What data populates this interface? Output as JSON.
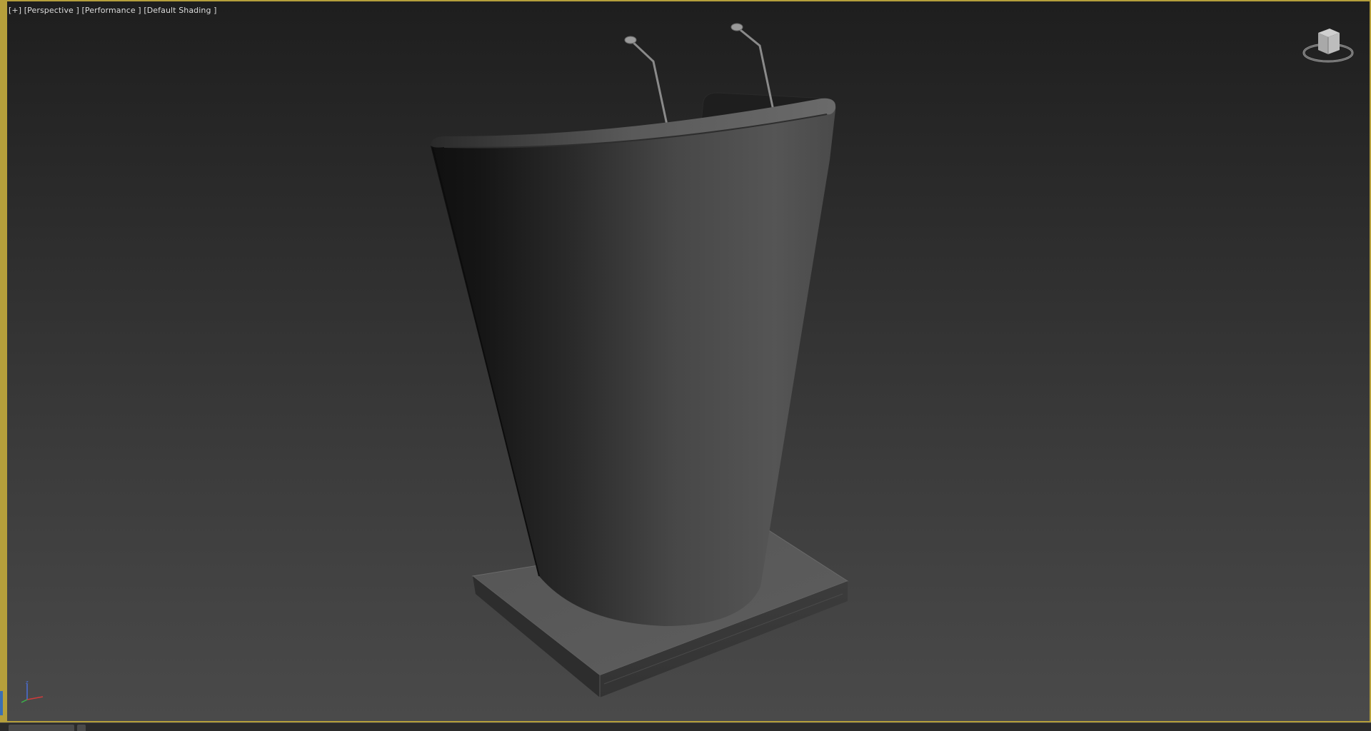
{
  "viewport": {
    "label_plus": "[+]",
    "label_view": "[Perspective ]",
    "label_performance": "[Performance ]",
    "label_shading": "[Default Shading ]"
  },
  "colors": {
    "viewport_border": "#b59f3b",
    "background_top": "#1e1e1e",
    "background_bottom": "#4a4a4a",
    "model_dark": "#121212",
    "model_light": "#5c5c5c",
    "base_top": "#585858",
    "axis_x": "#d13b3b",
    "axis_y": "#3bb44a",
    "axis_z": "#4a6fd8"
  },
  "icons": {
    "viewcube": "viewcube-icon",
    "axis": "axis-tripod-icon"
  },
  "scene": {
    "object": "podium-lectern-model"
  }
}
